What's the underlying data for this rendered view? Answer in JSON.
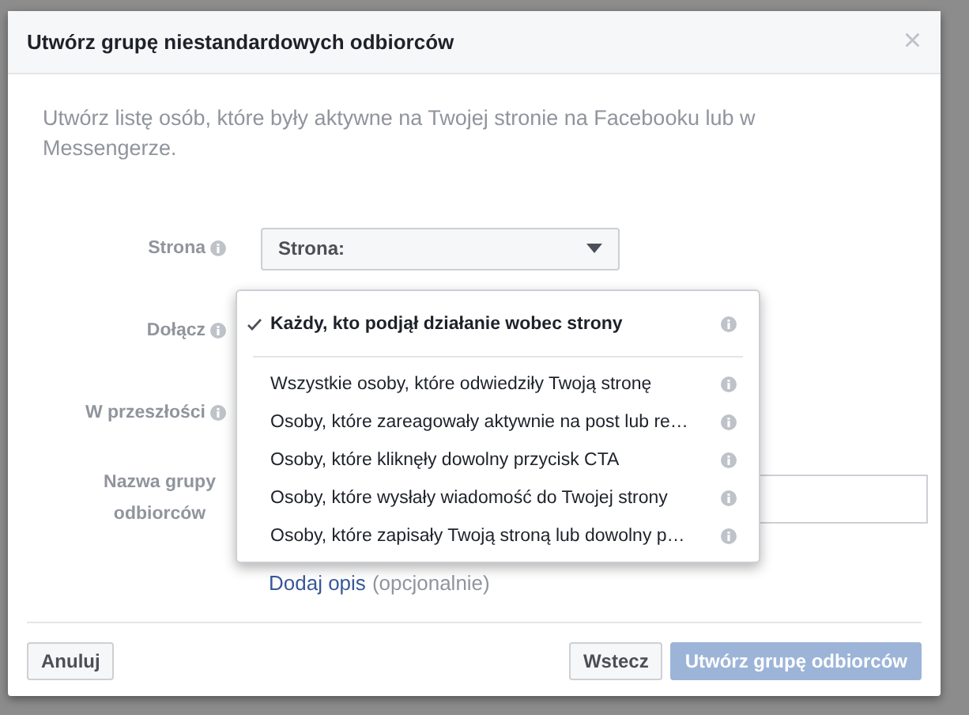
{
  "dialog": {
    "title": "Utwórz grupę niestandardowych odbiorców",
    "close": "×",
    "description": "Utwórz listę osób, które były aktywne na Twojej stronie na Facebooku lub w Messengerze.",
    "fields": [
      {
        "kind": "select",
        "label": "Strona",
        "value": "Strona:"
      },
      {
        "kind": "dropdown",
        "label": "Dołącz"
      },
      {
        "kind": "empty",
        "label": "W przeszłości"
      },
      {
        "kind": "input",
        "label": "Nazwa grupy odbiorców"
      }
    ],
    "add_description": {
      "link": "Dodaj opis",
      "hint": "(opcjonalnie)"
    },
    "menu": [
      {
        "label": "Każdy, kto podjął działanie wobec strony",
        "selected": true
      },
      {
        "label": "Wszystkie osoby, które odwiedziły Twoją stronę",
        "selected": false
      },
      {
        "label": "Osoby, które zareagowały aktywnie na post lub re…",
        "selected": false
      },
      {
        "label": "Osoby, które kliknęły dowolny przycisk CTA",
        "selected": false
      },
      {
        "label": "Osoby, które wysłały wiadomość do Twojej strony",
        "selected": false
      },
      {
        "label": "Osoby, które zapisały Twoją stroną lub dowolny p…",
        "selected": false
      }
    ],
    "buttons": [
      {
        "label": "Anuluj",
        "kind": "default"
      },
      {
        "label": "Wstecz",
        "kind": "default"
      },
      {
        "label": "Utwórz grupę odbiorców",
        "kind": "primary",
        "disabled": true
      }
    ]
  }
}
